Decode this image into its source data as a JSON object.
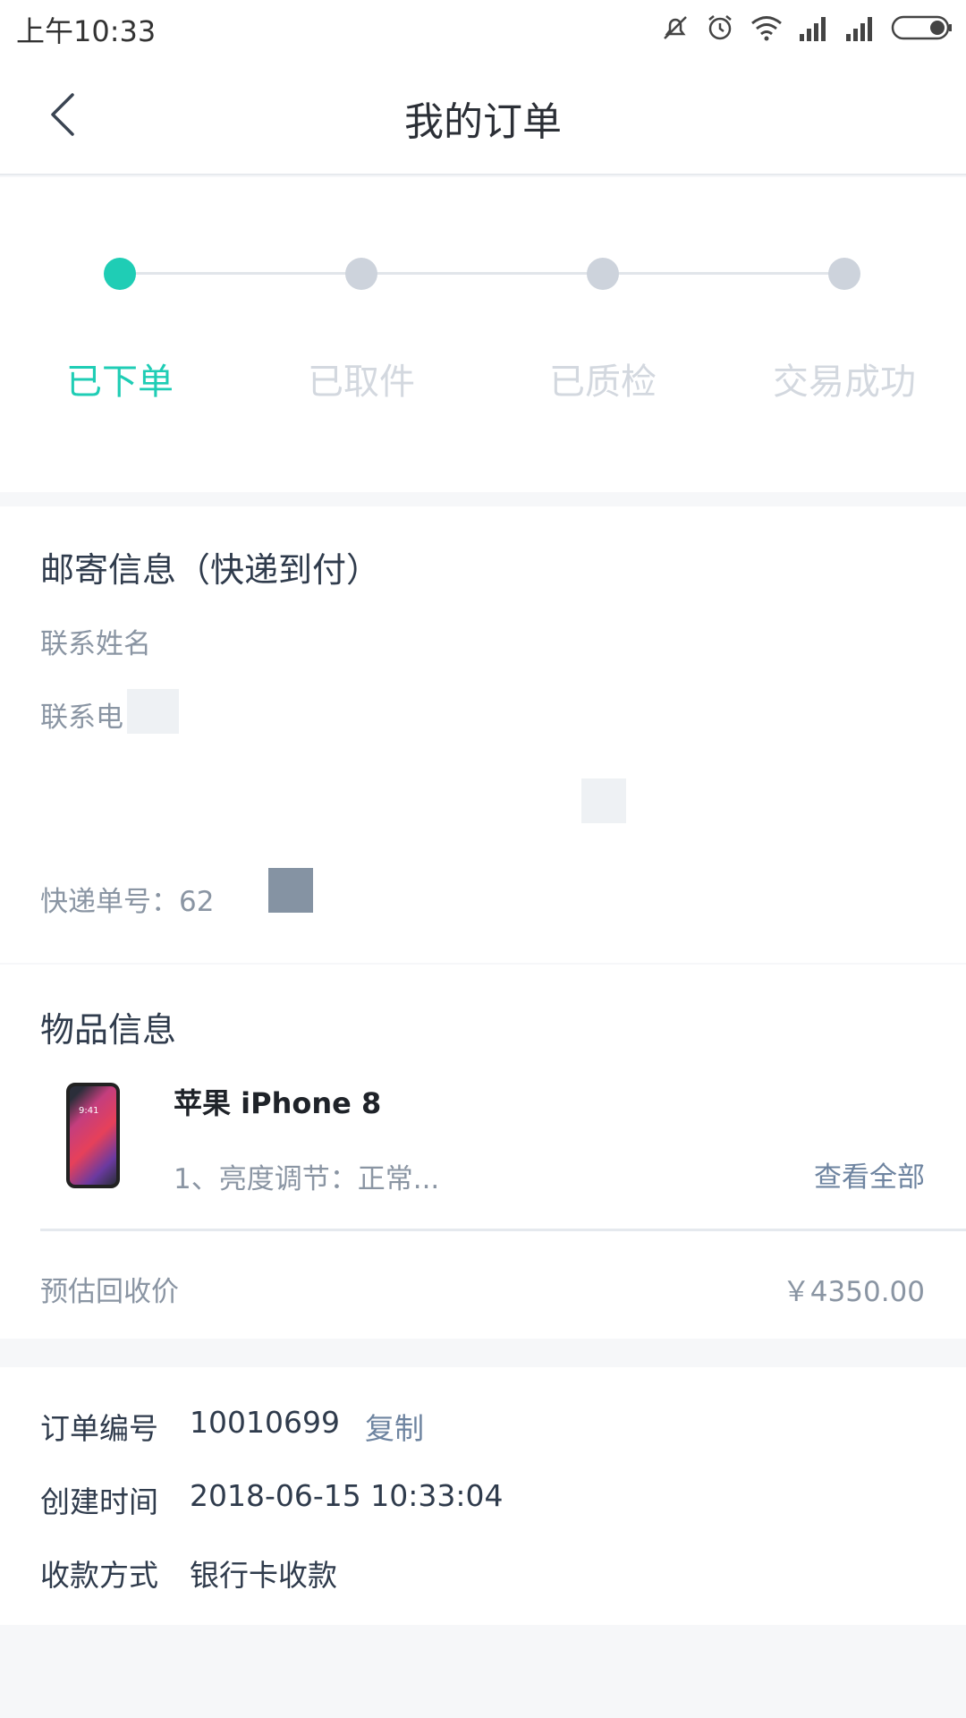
{
  "status_bar": {
    "time": "上午10:33",
    "icons": [
      "mute-icon",
      "alarm-icon",
      "wifi-icon",
      "signal-icon",
      "signal-icon",
      "battery-icon"
    ]
  },
  "header": {
    "title": "我的订单",
    "back_icon": "chevron-left-icon"
  },
  "steps": {
    "active_index": 0,
    "items": [
      {
        "label": "已下单"
      },
      {
        "label": "已取件"
      },
      {
        "label": "已质检"
      },
      {
        "label": "交易成功"
      }
    ],
    "colors": {
      "active": "#1fcdb5",
      "inactive": "#cdd3dc"
    }
  },
  "shipping": {
    "title": "邮寄信息（快递到付）",
    "contact_name_label": "联系姓名",
    "contact_phone_label": "联系电",
    "tracking_label": "快递单号：62"
  },
  "item": {
    "section_title": "物品信息",
    "name": "苹果 iPhone 8",
    "summary": "1、亮度调节：正常...",
    "view_all": "查看全部",
    "price_label": "预估回收价",
    "price_value": "￥4350.00",
    "image_time": "9:41"
  },
  "order": {
    "order_no_label": "订单编号",
    "order_no_value": "10010699",
    "copy_label": "复制",
    "created_label": "创建时间",
    "created_value": "2018-06-15 10:33:04",
    "payment_label": "收款方式",
    "payment_value": "银行卡收款"
  }
}
